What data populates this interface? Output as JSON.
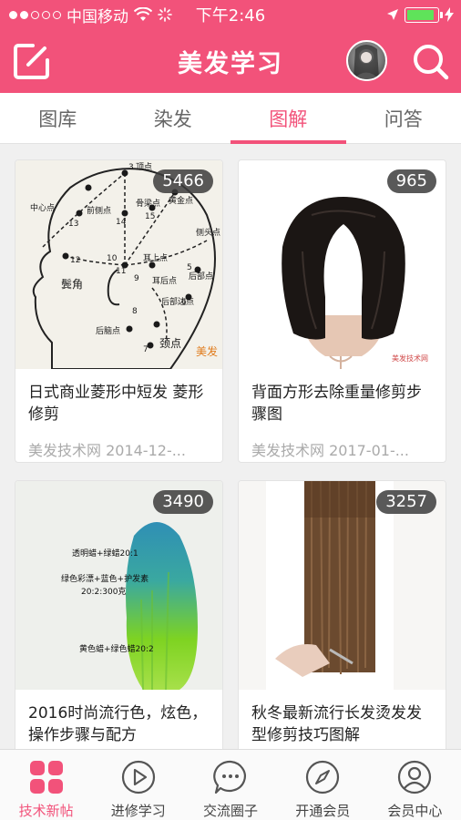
{
  "status": {
    "carrier": "中国移动",
    "time": "下午2:46",
    "battery_level": 0.9
  },
  "header": {
    "title": "美发学习",
    "colors": {
      "primary": "#f2527a"
    }
  },
  "tabs": [
    {
      "label": "图库",
      "active": false
    },
    {
      "label": "染发",
      "active": false
    },
    {
      "label": "图解",
      "active": true
    },
    {
      "label": "问答",
      "active": false
    }
  ],
  "cards": [
    {
      "title": "日式商业菱形中短发 菱形修剪",
      "meta": "美发技术网 2014-12-...",
      "count": "5466",
      "image_labels": [
        "3",
        "顶点",
        "中心点",
        "13",
        "黄金点",
        "前侧点",
        "14",
        "骨梁点",
        "15",
        "侧头点",
        "12",
        "10",
        "11",
        "耳上点",
        "9",
        "耳后点",
        "5",
        "后部点",
        "6",
        "后部边点",
        "鬓角",
        "8",
        "后脑点",
        "7",
        "颈点",
        "美发"
      ]
    },
    {
      "title": "背面方形去除重量修剪步骤图",
      "meta": "美发技术网 2017-01-...",
      "count": "965",
      "image_labels": [
        "美发技术网"
      ]
    },
    {
      "title": "2016时尚流行色，炫色，操作步骤与配方",
      "meta": "",
      "count": "3490",
      "image_labels": [
        "透明蜡+绿蜡20:1",
        "绿色彩漂+蓝色+护发素",
        "20:2:300克",
        "黄色蜡+绿色蜡20:2"
      ]
    },
    {
      "title": "秋冬最新流行长发烫发发型修剪技巧图解",
      "meta": "",
      "count": "3257",
      "image_labels": []
    }
  ],
  "tabbar": [
    {
      "label": "技术新帖",
      "icon": "grid-icon",
      "active": true
    },
    {
      "label": "进修学习",
      "icon": "play-icon",
      "active": false
    },
    {
      "label": "交流圈子",
      "icon": "chat-icon",
      "active": false
    },
    {
      "label": "开通会员",
      "icon": "compass-icon",
      "active": false
    },
    {
      "label": "会员中心",
      "icon": "user-icon",
      "active": false
    }
  ]
}
